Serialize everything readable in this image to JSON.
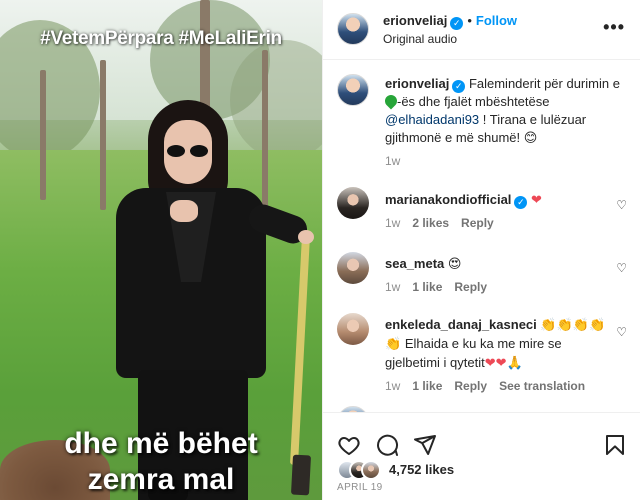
{
  "post": {
    "media": {
      "caption_top": "#VetemPërpara #MeLaliErin",
      "caption_bottom_line1": "dhe më bëhet",
      "caption_bottom_line2": "zemra mal"
    },
    "header": {
      "username": "erionveliaj",
      "separator": "•",
      "follow_label": "Follow",
      "audio_label": "Original audio",
      "more_label": "•••"
    },
    "caption_comment": {
      "username": "erionveliaj",
      "text_part1": "Faleminderit për durimin e",
      "text_part2": "-ës dhe fjalët mbështetëse",
      "mention": "@elhaidadani93",
      "text_part3": "! Tirana e lulëzuar gjithmonë e më shumë!",
      "emoji": "😊",
      "age": "1w"
    },
    "comments": [
      {
        "username": "marianakondiofficial",
        "text": "",
        "emoji": "❤",
        "age": "1w",
        "likes": "2 likes",
        "reply": "Reply"
      },
      {
        "username": "sea_meta",
        "text": "",
        "emoji": "😍",
        "age": "1w",
        "likes": "1 like",
        "reply": "Reply"
      },
      {
        "username": "enkeleda_danaj_kasneci",
        "emoji_after_name": "👏👏👏👏",
        "line2_emoji": "👏",
        "text": "Elhaida e ku ka me mire se gjelbetimi i qytetit",
        "emoji_end": "❤❤🙏",
        "age": "1w",
        "likes": "1 like",
        "reply": "Reply",
        "translation": "See translation"
      }
    ],
    "footer": {
      "likes": "4,752 likes",
      "date": "APRIL 19"
    }
  },
  "colors": {
    "accent": "#0095f6",
    "text": "#262626",
    "muted": "#8e8e8e",
    "mention": "#00376b",
    "heart": "#ed4956"
  },
  "icons": [
    "heart-icon",
    "comment-icon",
    "share-icon",
    "bookmark-icon",
    "verified-badge-icon",
    "more-icon"
  ]
}
